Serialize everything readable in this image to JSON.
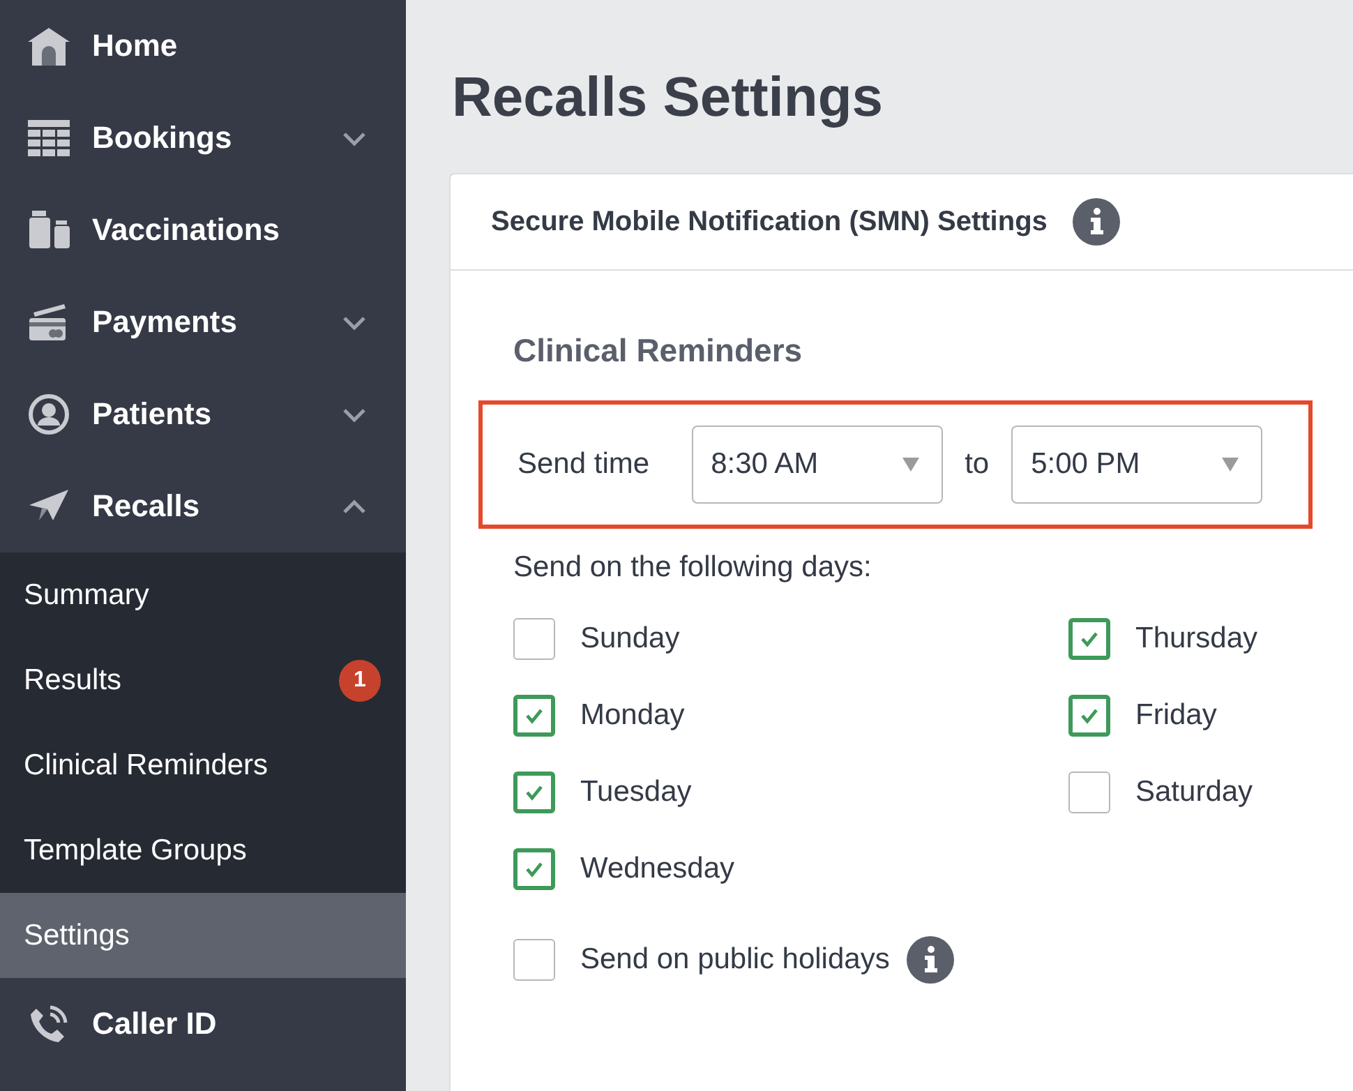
{
  "sidebar": {
    "items": [
      {
        "label": "Home"
      },
      {
        "label": "Bookings",
        "expanded": false
      },
      {
        "label": "Vaccinations"
      },
      {
        "label": "Payments",
        "expanded": false
      },
      {
        "label": "Patients",
        "expanded": false
      },
      {
        "label": "Recalls",
        "expanded": true,
        "children": [
          {
            "label": "Summary",
            "selected": false
          },
          {
            "label": "Results",
            "selected": false,
            "badge": "1"
          },
          {
            "label": "Clinical Reminders",
            "selected": false
          },
          {
            "label": "Template Groups",
            "selected": false
          },
          {
            "label": "Settings",
            "selected": true
          }
        ]
      },
      {
        "label": "Caller ID"
      }
    ]
  },
  "page_title": "Recalls Settings",
  "card": {
    "title": "Secure Mobile Notification (SMN) Settings",
    "section_title": "Clinical Reminders",
    "send_time": {
      "label": "Send time",
      "from": "8:30 AM",
      "separator": "to",
      "to": "5:00 PM",
      "highlighted": true
    },
    "days_label": "Send on the following days:",
    "days": [
      {
        "label": "Sunday",
        "checked": false
      },
      {
        "label": "Monday",
        "checked": true
      },
      {
        "label": "Tuesday",
        "checked": true
      },
      {
        "label": "Wednesday",
        "checked": true
      },
      {
        "label": "Thursday",
        "checked": true
      },
      {
        "label": "Friday",
        "checked": true
      },
      {
        "label": "Saturday",
        "checked": false
      }
    ],
    "public_holidays": {
      "label": "Send on public holidays",
      "checked": false
    }
  }
}
